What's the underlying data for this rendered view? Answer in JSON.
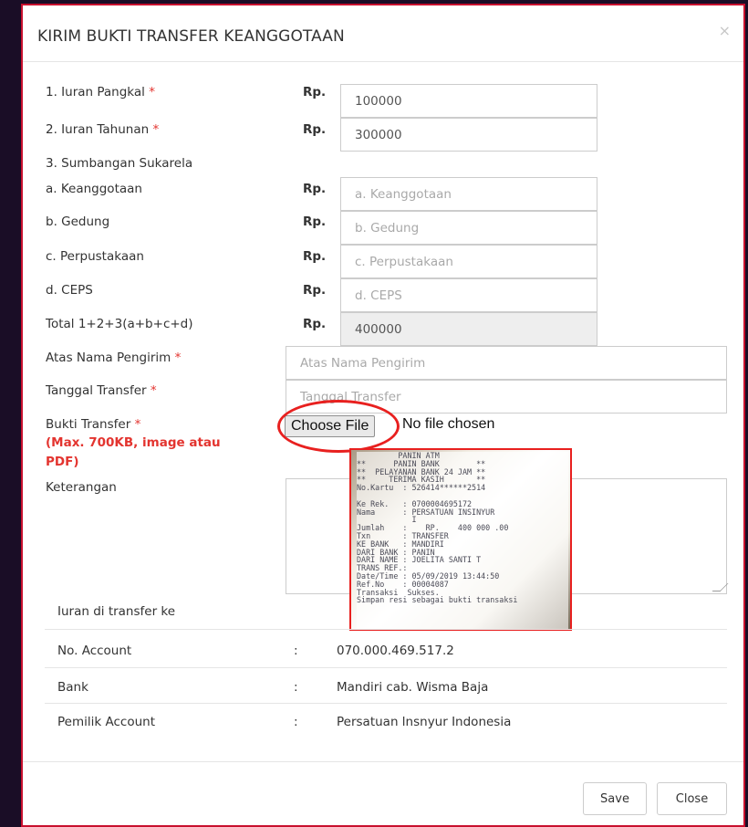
{
  "modal": {
    "title": "KIRIM BUKTI TRANSFER KEANGGOTAAN",
    "close_glyph": "×"
  },
  "currency_label": "Rp.",
  "required_mark": "*",
  "fields": {
    "iuran_pangkal": {
      "label": "1. Iuran Pangkal",
      "value": "100000"
    },
    "iuran_tahunan": {
      "label": "2. Iuran Tahunan",
      "value": "300000"
    },
    "sumbangan_header": "3. Sumbangan Sukarela",
    "keanggotaan": {
      "label": "a. Keanggotaan",
      "placeholder": "a. Keanggotaan"
    },
    "gedung": {
      "label": "b. Gedung",
      "placeholder": "b. Gedung"
    },
    "perpustakaan": {
      "label": "c. Perpustakaan",
      "placeholder": "c. Perpustakaan"
    },
    "ceps": {
      "label": "d. CEPS",
      "placeholder": "d. CEPS"
    },
    "total": {
      "label": "Total 1+2+3(a+b+c+d)",
      "value": "400000"
    },
    "atas_nama": {
      "label": "Atas Nama Pengirim",
      "placeholder": "Atas Nama Pengirim"
    },
    "tanggal": {
      "label": "Tanggal Transfer",
      "placeholder": "Tanggal Transfer"
    },
    "bukti": {
      "label": "Bukti Transfer",
      "hint_line1": "(Max. 700KB, image atau",
      "hint_line2": "PDF)",
      "button_label": "Choose File",
      "status": "No file chosen"
    },
    "keterangan": {
      "label": "Keterangan"
    }
  },
  "receipt_text": "         PANIN ATM\n**      PANIN BANK        **\n**  PELAYANAN BANK 24 JAM **\n**     TERIMA KASIH       **\nNo.Kartu  : 526414******2514\n\nKe Rek.   : 0700004695172\nNama      : PERSATUAN INSINYUR\n            I\nJumlah    :    RP.    400 000 .00\nTxn       : TRANSFER\nKE BANK   : MANDIRI\nDARI BANK : PANIN\nDARI NAME : JOELITA SANTI T\nTRANS REF.:\nDate/Time : 05/09/2019 13:44:50\nRef.No    : 00004087\nTransaksi  Sukses.\nSimpan resi sebagai bukti transaksi",
  "transfer_info": {
    "heading": "Iuran di transfer ke",
    "separator": ":",
    "rows": [
      {
        "label": "No. Account",
        "value": "070.000.469.517.2"
      },
      {
        "label": "Bank",
        "value": "Mandiri cab. Wisma Baja"
      },
      {
        "label": "Pemilik Account",
        "value": "Persatuan lnsnyur Indonesia"
      }
    ]
  },
  "buttons": {
    "save": "Save",
    "close": "Close"
  },
  "colors": {
    "required": "#e3342f",
    "annotation": "#e8201f",
    "backdrop": "#1a0d26"
  }
}
